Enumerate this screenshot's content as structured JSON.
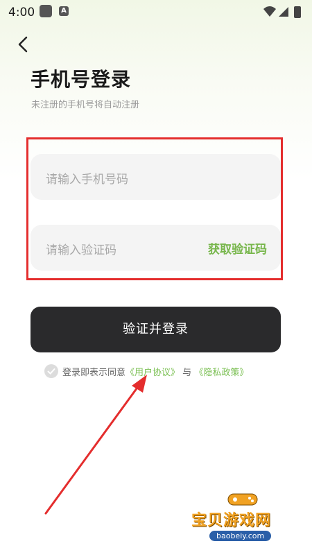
{
  "status_bar": {
    "time": "4:00",
    "app_icon_letter": "A"
  },
  "header": {
    "title": "手机号登录",
    "subtitle": "未注册的手机号将自动注册"
  },
  "form": {
    "phone_placeholder": "请输入手机号码",
    "code_placeholder": "请输入验证码",
    "get_code_label": "获取验证码"
  },
  "login_button": {
    "label": "验证并登录"
  },
  "agreement": {
    "prefix": "登录即表示同意",
    "user_agreement": "《用户协议》",
    "conjunction": "与",
    "privacy_policy": "《隐私政策》"
  },
  "watermark": {
    "title": "宝贝游戏网",
    "url": "baobeiy.com"
  },
  "colors": {
    "accent_green": "#77b64b",
    "dark_button": "#2a2a2c",
    "highlight_red": "#e42d2d",
    "watermark_orange": "#f1a223"
  },
  "icons": [
    "back-arrow-icon",
    "wifi-icon",
    "signal-icon",
    "battery-icon",
    "checkbox-icon"
  ]
}
